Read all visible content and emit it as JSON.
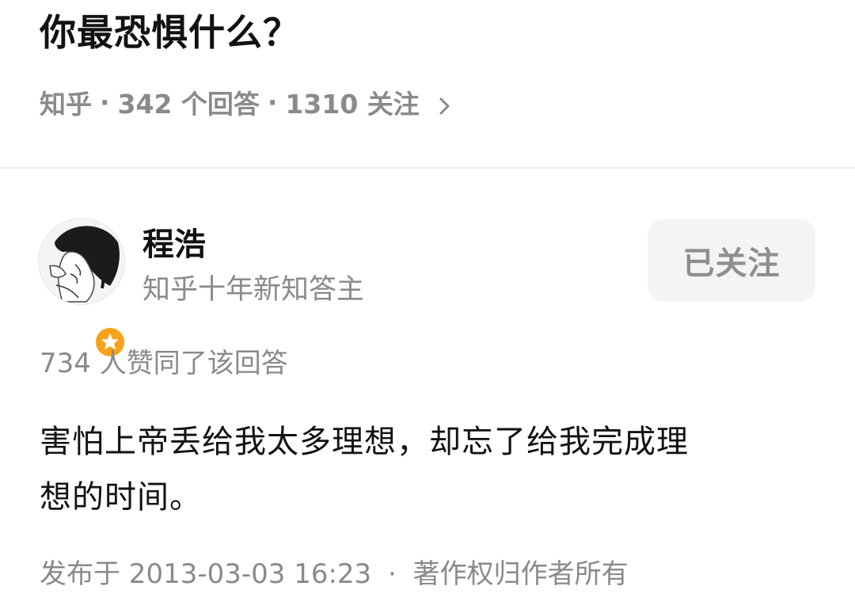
{
  "question": {
    "title": "你最恐惧什么？",
    "meta": {
      "source": "知乎",
      "answers": "342 个回答",
      "followers": "1310 关注",
      "separator": "·"
    }
  },
  "answer": {
    "author": {
      "name": "程浩",
      "title": "知乎十年新知答主"
    },
    "follow_button": "已关注",
    "vote_summary": "734 人赞同了该回答",
    "content_line1": "害怕上帝丢给我太多理想，却忘了给我完成理",
    "content_line2": "想的时间。",
    "footer": {
      "published": "发布于 2013-03-03 16:23",
      "separator": "·",
      "copyright": "著作权归作者所有"
    }
  },
  "colors": {
    "badge": "#f7a21b",
    "meta_text": "#8a8a8a",
    "title_text": "#121212",
    "button_bg": "#f4f4f4",
    "divider": "#ececec"
  },
  "icons": {
    "meta_arrow": "chevron-right-icon",
    "badge": "star-badge-icon"
  }
}
